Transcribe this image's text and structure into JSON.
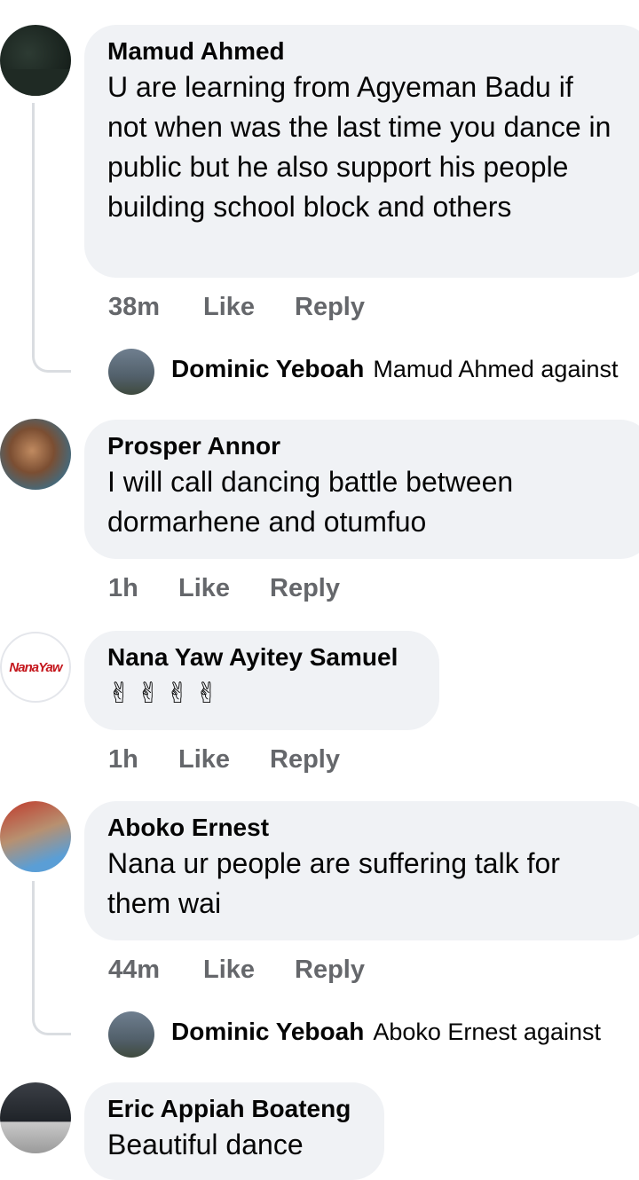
{
  "comments": [
    {
      "author": "Mamud Ahmed",
      "text": "U are learning from Agyeman Badu if not when was the last time you dance in public but he also support his people building school block and others",
      "time": "38m",
      "like": "Like",
      "reply": "Reply",
      "reply_preview": {
        "author": "Dominic Yeboah",
        "text": "Mamud Ahmed against"
      }
    },
    {
      "author": "Prosper Annor",
      "text": "I will call dancing battle between dormarhene and otumfuo",
      "time": "1h",
      "like": "Like",
      "reply": "Reply"
    },
    {
      "author": "Nana Yaw Ayitey Samuel",
      "avatar_text": "NanaYaw",
      "text": "✌✌✌✌",
      "time": "1h",
      "like": "Like",
      "reply": "Reply"
    },
    {
      "author": "Aboko Ernest",
      "text": "Nana ur people are suffering talk for them wai",
      "time": "44m",
      "like": "Like",
      "reply": "Reply",
      "reply_preview": {
        "author": "Dominic Yeboah",
        "text": "Aboko Ernest against"
      }
    },
    {
      "author": "Eric Appiah Boateng",
      "text": "Beautiful dance"
    }
  ],
  "colors": {
    "bubble": "#f0f2f5",
    "meta": "#65676b",
    "thread": "#dadde1"
  }
}
